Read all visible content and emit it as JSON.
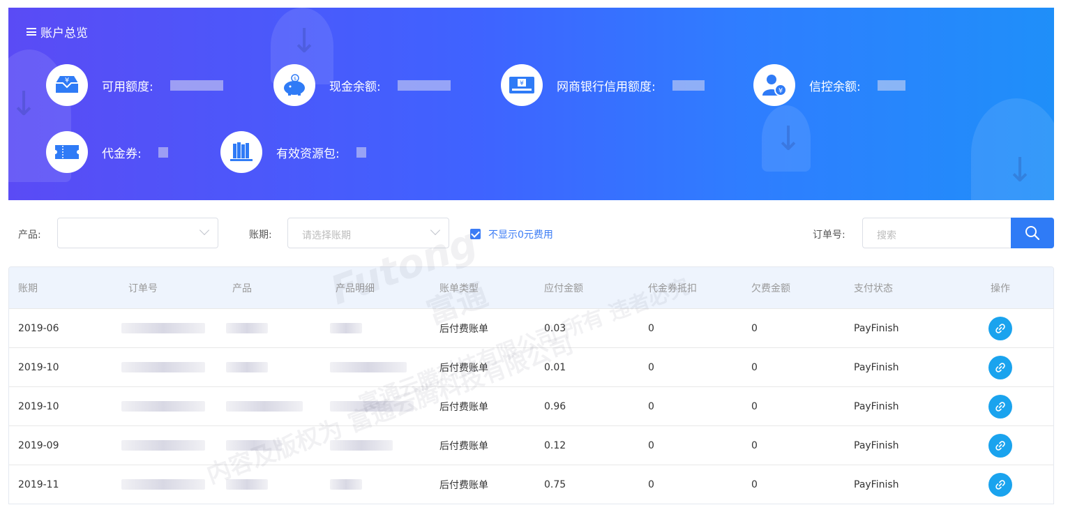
{
  "banner": {
    "title": "账户总览",
    "stats": [
      {
        "label": "可用额度:",
        "icon": "wallet-yuan-icon"
      },
      {
        "label": "现金余额:",
        "icon": "piggy-bank-icon"
      },
      {
        "label": "网商银行信用额度:",
        "icon": "bank-card-icon"
      },
      {
        "label": "信控余额:",
        "icon": "user-yuan-icon"
      },
      {
        "label": "代金券:",
        "icon": "ticket-icon"
      },
      {
        "label": "有效资源包:",
        "icon": "books-icon"
      }
    ]
  },
  "filters": {
    "product_label": "产品:",
    "product_value": "",
    "period_label": "账期:",
    "period_placeholder": "请选择账期",
    "hide_zero_label": "不显示0元费用",
    "hide_zero_checked": true,
    "order_label": "订单号:",
    "search_placeholder": "搜索"
  },
  "table": {
    "headers": [
      "账期",
      "订单号",
      "产品",
      "产品明细",
      "账单类型",
      "应付金额",
      "代金券抵扣",
      "欠费金额",
      "支付状态",
      "操作"
    ],
    "rows": [
      {
        "period": "2019-06",
        "type": "后付费账单",
        "amount": "0.03",
        "voucher": "0",
        "arrears": "0",
        "status": "PayFinish"
      },
      {
        "period": "2019-10",
        "type": "后付费账单",
        "amount": "0.01",
        "voucher": "0",
        "arrears": "0",
        "status": "PayFinish"
      },
      {
        "period": "2019-10",
        "type": "后付费账单",
        "amount": "0.96",
        "voucher": "0",
        "arrears": "0",
        "status": "PayFinish"
      },
      {
        "period": "2019-09",
        "type": "后付费账单",
        "amount": "0.12",
        "voucher": "0",
        "arrears": "0",
        "status": "PayFinish"
      },
      {
        "period": "2019-11",
        "type": "后付费账单",
        "amount": "0.75",
        "voucher": "0",
        "arrears": "0",
        "status": "PayFinish"
      }
    ]
  },
  "watermark": {
    "line1": "Futong",
    "line2": "富通",
    "line3": "富通云腾科技有限公司 所有 违者必究",
    "line4": "内容及版权为 富通云腾科技有限公司"
  },
  "colors": {
    "accent": "#2f7bf6",
    "link_button": "#1aa3ee",
    "header_bg": "#eef4fd"
  }
}
